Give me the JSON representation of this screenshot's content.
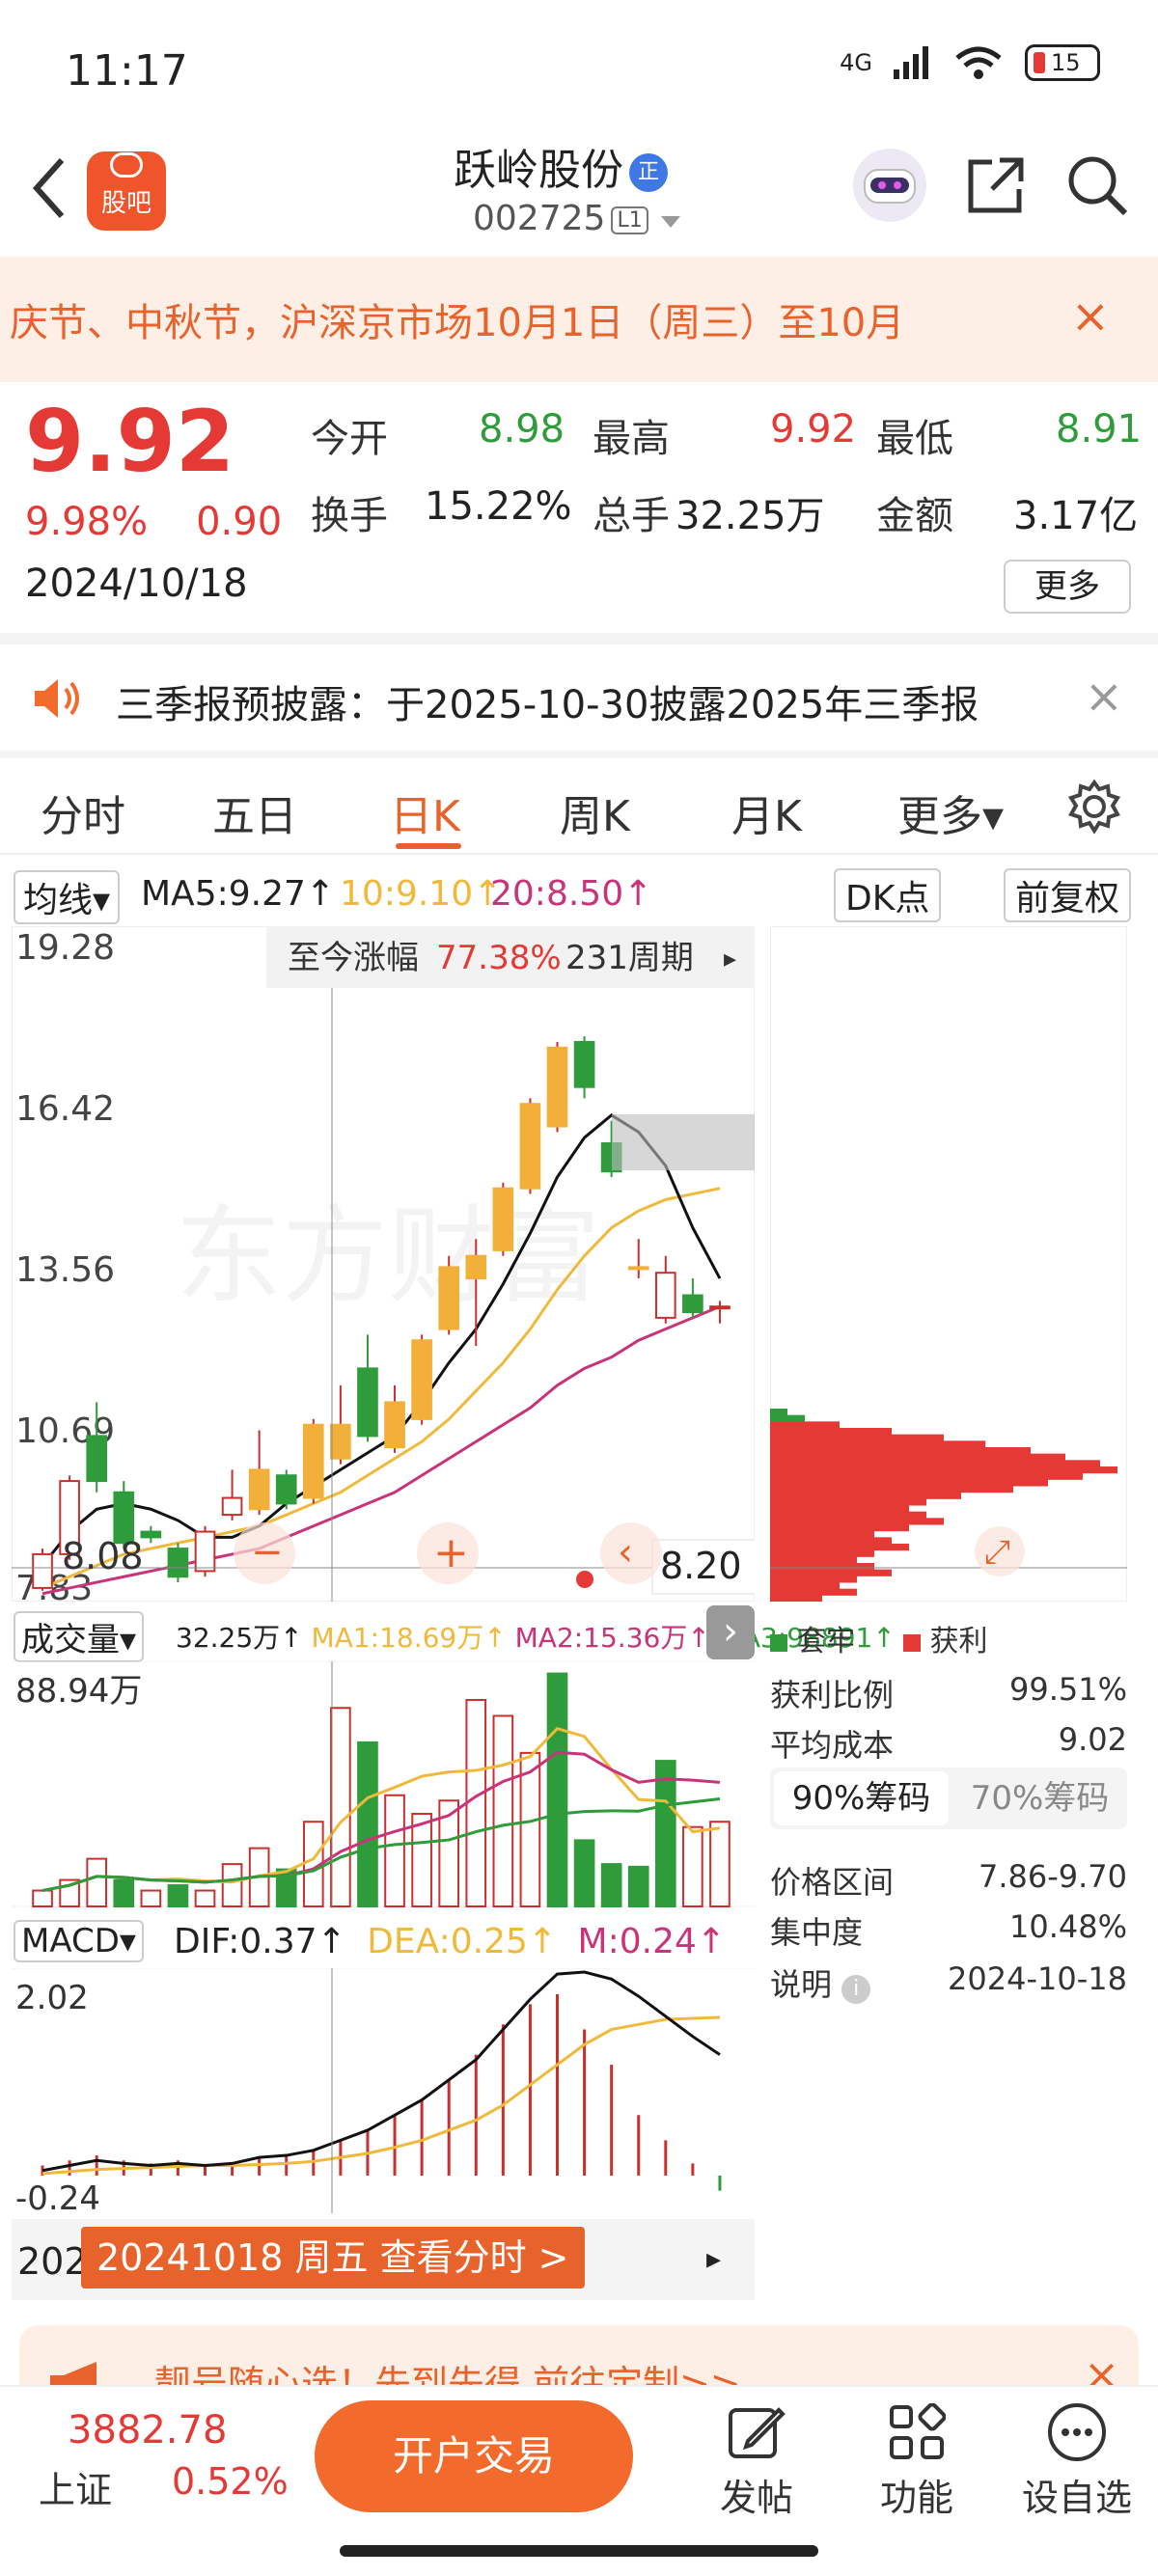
{
  "status_bar": {
    "time": "11:17",
    "network": "4G",
    "battery": "15"
  },
  "header": {
    "back": "<",
    "guba_label": "股吧",
    "stock_name": "跃岭股份",
    "badge": "正",
    "stock_code": "002725",
    "level": "L1"
  },
  "notice": {
    "text": "庆节、中秋节，沪深京市场10月1日（周三）至10月",
    "close": "×"
  },
  "quote": {
    "price": "9.92",
    "change_pct": "9.98%",
    "change": "0.90",
    "date": "2024/10/18",
    "open_label": "今开",
    "open": "8.98",
    "high_label": "最高",
    "high": "9.92",
    "low_label": "最低",
    "low": "8.91",
    "turnover_label": "换手",
    "turnover": "15.22%",
    "volume_label": "总手",
    "volume": "32.25万",
    "amount_label": "金额",
    "amount": "3.17亿",
    "more": "更多"
  },
  "announcement": {
    "text": "三季报预披露：于2025-10-30披露2025年三季报",
    "close": "×"
  },
  "tabs": [
    "分时",
    "五日",
    "日K",
    "周K",
    "月K",
    "更多▾"
  ],
  "active_tab": 2,
  "ma_row": {
    "selector": "均线▾",
    "ma5": "MA5:9.27↑",
    "ma10": "10:9.10↑",
    "ma20": "20:8.50↑",
    "dk": "DK点",
    "fq": "前复权"
  },
  "colors": {
    "up": "#e53935",
    "down": "#2e9c3a",
    "accent": "#f26a2c",
    "ma5": "#111111",
    "ma10": "#f0b93a",
    "ma20": "#c8337a",
    "candle_up": "#f2b03a"
  },
  "main_chart": {
    "y_labels": [
      "19.28",
      "16.42",
      "13.56",
      "10.69",
      "7.83"
    ],
    "range_box": {
      "label": "至今涨幅",
      "value": "77.38%",
      "period": "231周期",
      "arrow": "▸"
    },
    "left_price": "8.08",
    "cross_price": "8.20",
    "watermark": "东方财富"
  },
  "chart_data": {
    "type": "candlestick",
    "ylim": [
      7.83,
      19.28
    ],
    "candles": [
      {
        "o": 7.9,
        "c": 8.5,
        "h": 8.6,
        "l": 7.85
      },
      {
        "o": 8.5,
        "c": 9.8,
        "h": 9.9,
        "l": 8.4
      },
      {
        "o": 10.6,
        "c": 9.8,
        "h": 11.2,
        "l": 9.6
      },
      {
        "o": 9.6,
        "c": 8.7,
        "h": 9.8,
        "l": 8.6
      },
      {
        "o": 8.9,
        "c": 8.8,
        "h": 9.0,
        "l": 8.7
      },
      {
        "o": 8.6,
        "c": 8.1,
        "h": 8.7,
        "l": 8.0
      },
      {
        "o": 8.2,
        "c": 8.9,
        "h": 9.0,
        "l": 8.1
      },
      {
        "o": 9.2,
        "c": 9.5,
        "h": 10.0,
        "l": 9.1
      },
      {
        "o": 9.3,
        "c": 10.0,
        "h": 10.7,
        "l": 9.2
      },
      {
        "o": 9.9,
        "c": 9.4,
        "h": 10.0,
        "l": 9.3
      },
      {
        "o": 9.5,
        "c": 10.8,
        "h": 10.9,
        "l": 9.4
      },
      {
        "o": 10.2,
        "c": 10.8,
        "h": 11.5,
        "l": 10.1
      },
      {
        "o": 11.8,
        "c": 10.6,
        "h": 12.4,
        "l": 10.5
      },
      {
        "o": 10.4,
        "c": 11.2,
        "h": 11.5,
        "l": 10.3
      },
      {
        "o": 10.9,
        "c": 12.3,
        "h": 12.4,
        "l": 10.8
      },
      {
        "o": 12.5,
        "c": 13.6,
        "h": 13.8,
        "l": 12.4
      },
      {
        "o": 13.4,
        "c": 13.8,
        "h": 14.1,
        "l": 12.2
      },
      {
        "o": 13.9,
        "c": 15.0,
        "h": 15.1,
        "l": 13.8
      },
      {
        "o": 15.0,
        "c": 16.5,
        "h": 16.6,
        "l": 14.9
      },
      {
        "o": 16.1,
        "c": 17.5,
        "h": 17.6,
        "l": 16.0
      },
      {
        "o": 17.6,
        "c": 16.8,
        "h": 17.7,
        "l": 16.6
      },
      {
        "o": 15.8,
        "c": 15.3,
        "h": 16.2,
        "l": 15.2
      },
      {
        "o": 13.6,
        "c": 13.6,
        "h": 14.1,
        "l": 13.4
      },
      {
        "o": 12.7,
        "c": 13.5,
        "h": 13.8,
        "l": 12.6
      },
      {
        "o": 13.1,
        "c": 12.8,
        "h": 13.4,
        "l": 12.7
      },
      {
        "o": 12.9,
        "c": 12.9,
        "h": 13.0,
        "l": 12.6
      }
    ],
    "ma5": [
      8.3,
      8.9,
      9.3,
      9.4,
      9.3,
      9.1,
      8.8,
      8.8,
      9.0,
      9.4,
      9.7,
      10.0,
      10.3,
      10.6,
      11.2,
      11.9,
      12.5,
      13.3,
      14.2,
      15.2,
      15.9,
      16.3,
      16.0,
      15.4,
      14.3,
      13.4
    ],
    "ma10": [
      7.9,
      8.1,
      8.3,
      8.5,
      8.6,
      8.7,
      8.8,
      8.9,
      9.0,
      9.2,
      9.4,
      9.6,
      9.9,
      10.2,
      10.5,
      10.9,
      11.4,
      11.9,
      12.5,
      13.2,
      13.8,
      14.3,
      14.6,
      14.8,
      14.9,
      15.0
    ],
    "ma20": [
      7.8,
      7.9,
      8.0,
      8.1,
      8.2,
      8.3,
      8.4,
      8.5,
      8.6,
      8.8,
      9.0,
      9.2,
      9.4,
      9.6,
      9.9,
      10.2,
      10.5,
      10.8,
      11.1,
      11.5,
      11.8,
      12.0,
      12.3,
      12.5,
      12.7,
      12.9
    ]
  },
  "volume_panel": {
    "selector": "成交量▾",
    "vol": "32.25万↑",
    "ma1": "MA1:18.69万↑",
    "ma2": "MA2:15.36万↑",
    "ma3": "MA3:98891↑",
    "max_label": "88.94万"
  },
  "volume_data": {
    "max": 88.94,
    "bars": [
      6,
      10,
      18,
      10,
      6,
      8,
      6,
      16,
      22,
      14,
      32,
      75,
      62,
      42,
      35,
      40,
      78,
      72,
      58,
      88,
      25,
      16,
      15,
      55,
      30,
      32
    ],
    "up": [
      1,
      1,
      1,
      0,
      1,
      0,
      1,
      1,
      1,
      0,
      1,
      1,
      0,
      1,
      1,
      1,
      1,
      1,
      1,
      0,
      0,
      0,
      0,
      0,
      1,
      1
    ]
  },
  "macd_panel": {
    "selector": "MACD▾",
    "dif": "DIF:0.37↑",
    "dea": "DEA:0.25↑",
    "m": "M:0.24↑",
    "top_label": "2.02",
    "bottom_label": "-0.24"
  },
  "macd_data": {
    "max": 2.02,
    "min": -0.24,
    "dif": [
      0.05,
      0.1,
      0.15,
      0.12,
      0.1,
      0.12,
      0.1,
      0.12,
      0.18,
      0.2,
      0.25,
      0.35,
      0.45,
      0.6,
      0.75,
      0.95,
      1.15,
      1.45,
      1.75,
      2.0,
      2.02,
      1.95,
      1.78,
      1.58,
      1.38,
      1.2
    ],
    "dea": [
      0.02,
      0.04,
      0.06,
      0.07,
      0.08,
      0.09,
      0.1,
      0.1,
      0.11,
      0.12,
      0.14,
      0.18,
      0.22,
      0.28,
      0.35,
      0.45,
      0.55,
      0.7,
      0.9,
      1.1,
      1.3,
      1.45,
      1.5,
      1.55,
      1.56,
      1.57
    ],
    "m": [
      0.1,
      0.15,
      0.2,
      0.15,
      0.12,
      0.15,
      0.1,
      0.12,
      0.18,
      0.2,
      0.25,
      0.35,
      0.45,
      0.6,
      0.75,
      0.95,
      1.2,
      1.5,
      1.7,
      1.8,
      1.45,
      1.1,
      0.6,
      0.35,
      0.12,
      -0.15
    ]
  },
  "date_bar": {
    "prefix": "202",
    "label": "20241018 周五 查看分时 >",
    "arrow": "▸"
  },
  "chips": {
    "legend_trap": "套牢",
    "legend_profit": "获利",
    "profit_ratio_label": "获利比例",
    "profit_ratio": "99.51%",
    "avg_cost_label": "平均成本",
    "avg_cost": "9.02",
    "tab90": "90%筹码",
    "tab70": "70%筹码",
    "range_label": "价格区间",
    "range": "7.86-9.70",
    "conc_label": "集中度",
    "conc": "10.48%",
    "note_label": "说明",
    "note_date": "2024-10-18",
    "profile": [
      0.05,
      0.1,
      0.2,
      0.35,
      0.5,
      0.62,
      0.75,
      0.85,
      0.95,
      1.0,
      0.9,
      0.8,
      0.7,
      0.55,
      0.45,
      0.4,
      0.45,
      0.5,
      0.4,
      0.3,
      0.35,
      0.4,
      0.3,
      0.25,
      0.3,
      0.35,
      0.25,
      0.2,
      0.25,
      0.15
    ]
  },
  "ad": {
    "text": "靓号随心选！先到先得 前往定制>>",
    "close": "×"
  },
  "bottom_bar": {
    "index_value": "3882.78",
    "index_name": "上证",
    "index_pct": "0.52%",
    "trade": "开户交易",
    "post": "发帖",
    "func": "功能",
    "watch": "设自选"
  }
}
